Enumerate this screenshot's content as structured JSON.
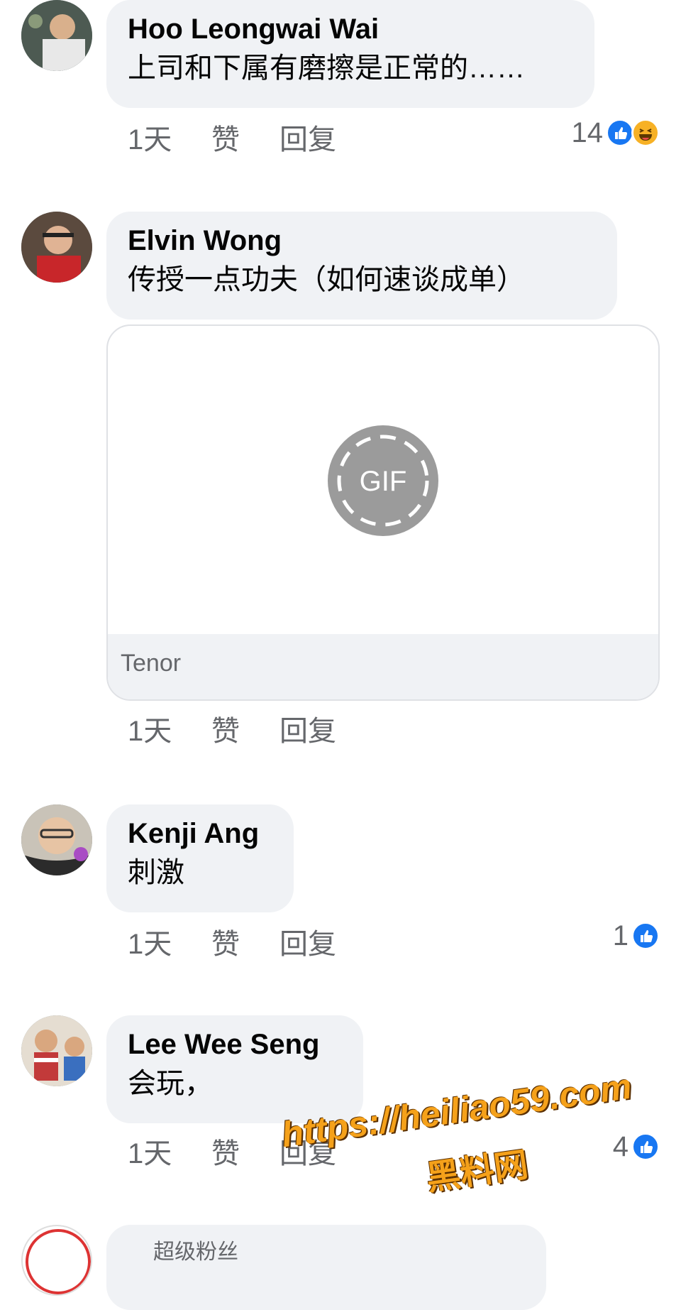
{
  "comments": [
    {
      "name": "Hoo Leongwai Wai",
      "text": "上司和下属有磨擦是正常的……",
      "time": "1天",
      "like": "赞",
      "reply": "回复",
      "reaction_count": "14",
      "reactions": [
        "like-icon",
        "haha-icon"
      ]
    },
    {
      "name": "Elvin Wong",
      "text": "传授一点功夫（如何速谈成单）",
      "gif_label": "GIF",
      "gif_source": "Tenor",
      "time": "1天",
      "like": "赞",
      "reply": "回复"
    },
    {
      "name": "Kenji Ang",
      "text": "刺激",
      "time": "1天",
      "like": "赞",
      "reply": "回复",
      "reaction_count": "1",
      "reactions": [
        "like-icon"
      ]
    },
    {
      "name": "Lee Wee Seng",
      "text": "会玩，",
      "time": "1天",
      "like": "赞",
      "reply": "回复",
      "reaction_count": "4",
      "reactions": [
        "like-icon"
      ]
    },
    {
      "name": "超级粉丝"
    }
  ],
  "watermark": {
    "url": "https://heiliao59.com",
    "label": "黑料网"
  },
  "colors": {
    "bubble": "#f0f2f5",
    "like": "#1877f2",
    "haha": "#f7b125",
    "muted": "#65676b"
  }
}
